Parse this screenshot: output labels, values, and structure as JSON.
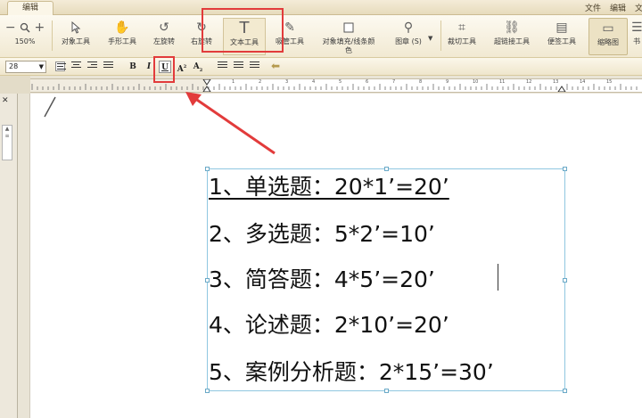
{
  "menu": {
    "edit_tab": "编辑",
    "file": "文件",
    "edit": "编辑"
  },
  "ribbon": {
    "zoom_value": "150%",
    "tools": [
      {
        "label": "对象工具"
      },
      {
        "label": "手形工具"
      },
      {
        "label": "左旋转"
      },
      {
        "label": "右旋转"
      },
      {
        "label": "文本工具"
      },
      {
        "label": "吸管工具"
      },
      {
        "label": "对象填充/线条颜",
        "label2": "色"
      },
      {
        "label": "图章 (S)"
      },
      {
        "label": "裁切工具"
      },
      {
        "label": "超链接工具"
      },
      {
        "label": "便签工具"
      },
      {
        "label": "缩略图"
      },
      {
        "label": "书"
      }
    ]
  },
  "format": {
    "font_size": "28",
    "bold": "B",
    "italic": "I",
    "underline": "U",
    "superscript": "A",
    "subscript": "A"
  },
  "ruler": {
    "numbers": [
      "1",
      "2",
      "3",
      "4",
      "5",
      "6",
      "7",
      "8",
      "9",
      "10",
      "11",
      "12",
      "13",
      "14",
      "15"
    ]
  },
  "document": {
    "lines": [
      "1、单选题：20*1’=20’",
      "2、多选题：5*2’=10’",
      "3、简答题：4*5’=20’",
      "4、论述题：2*10’=20’",
      "5、案例分析题：2*15’=30’"
    ]
  },
  "colors": {
    "annotation": "#e23b3b",
    "textbox_border": "#8fc7e0"
  }
}
